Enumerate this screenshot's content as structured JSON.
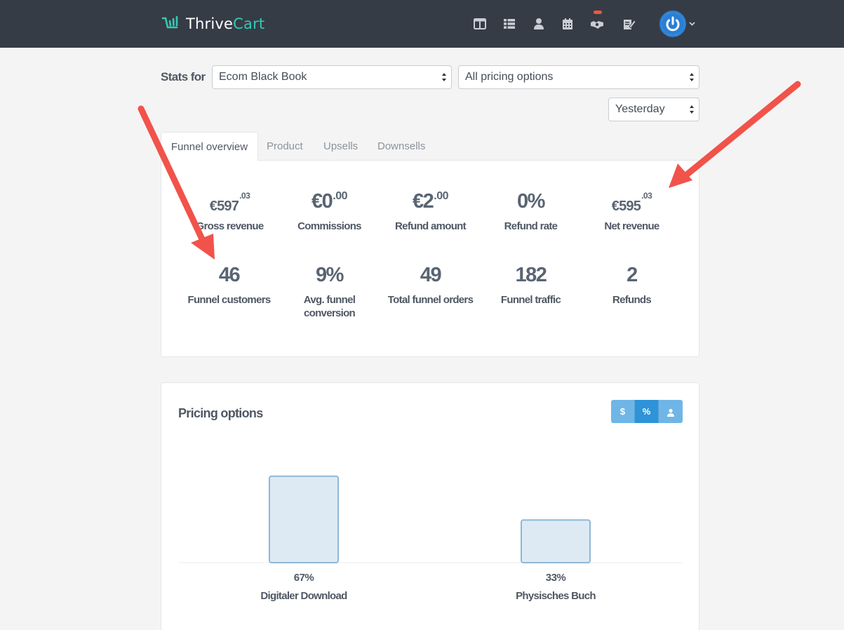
{
  "header": {
    "logo": {
      "prefix": "Thrive",
      "suffix": "Cart"
    },
    "nav_icons": [
      "layout-icon",
      "list-icon",
      "user-icon",
      "calendar-icon",
      "handshake-icon",
      "signature-icon"
    ],
    "brand_color": "#35c9b4",
    "notification_color": "#e85a3f"
  },
  "stats_filter": {
    "label": "Stats for",
    "product": "Ecom Black Book",
    "pricing": "All pricing options",
    "date_range": "Yesterday"
  },
  "tabs": [
    {
      "label": "Funnel overview",
      "active": true
    },
    {
      "label": "Product",
      "active": false
    },
    {
      "label": "Upsells",
      "active": false
    },
    {
      "label": "Downsells",
      "active": false
    }
  ],
  "stats": {
    "gross_revenue": {
      "currency": "€",
      "whole": "597",
      "cents": ".03",
      "label": "Gross revenue"
    },
    "commissions": {
      "currency": "€",
      "whole": "0",
      "cents": ".00",
      "label": "Commissions"
    },
    "refund_amount": {
      "currency": "€",
      "whole": "2",
      "cents": ".00",
      "label": "Refund amount"
    },
    "refund_rate": {
      "value": "0%",
      "label": "Refund rate"
    },
    "net_revenue": {
      "currency": "€",
      "whole": "595",
      "cents": ".03",
      "label": "Net revenue"
    },
    "funnel_customers": {
      "value": "46",
      "label": "Funnel customers"
    },
    "avg_conversion": {
      "value": "9%",
      "label": "Avg. funnel conversion"
    },
    "total_orders": {
      "value": "49",
      "label": "Total funnel orders"
    },
    "funnel_traffic": {
      "value": "182",
      "label": "Funnel traffic"
    },
    "refunds": {
      "value": "2",
      "label": "Refunds"
    }
  },
  "pricing": {
    "title": "Pricing options",
    "buttons": [
      {
        "label": "$",
        "active": false
      },
      {
        "label": "%",
        "active": true
      },
      {
        "label": "",
        "icon": "user-icon",
        "active": false
      }
    ]
  },
  "chart_data": {
    "type": "bar",
    "categories": [
      "Digitaler Download",
      "Physisches Buch"
    ],
    "values": [
      67,
      33
    ],
    "labels": [
      "67%",
      "33%"
    ],
    "ylim": [
      0,
      100
    ],
    "bar_color": "#ddeaf4",
    "bar_border": "#8fb7d6",
    "grid": false
  },
  "annotation_color": "#f1534a"
}
